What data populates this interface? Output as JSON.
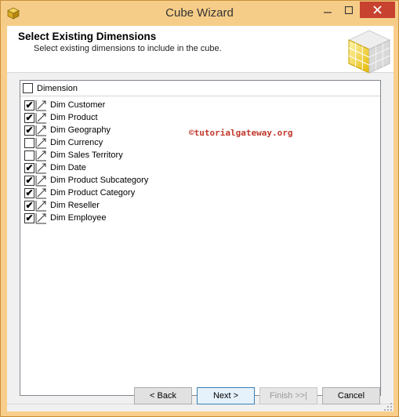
{
  "window": {
    "title": "Cube Wizard"
  },
  "header": {
    "title": "Select Existing Dimensions",
    "subtitle": "Select existing dimensions to include in the cube."
  },
  "list": {
    "column_header": "Dimension",
    "select_all_checked": false,
    "items": [
      {
        "label": "Dim Customer",
        "checked": true
      },
      {
        "label": "Dim Product",
        "checked": true
      },
      {
        "label": "Dim Geography",
        "checked": true
      },
      {
        "label": "Dim Currency",
        "checked": false
      },
      {
        "label": "Dim Sales Territory",
        "checked": false
      },
      {
        "label": "Dim Date",
        "checked": true
      },
      {
        "label": "Dim Product Subcategory",
        "checked": true
      },
      {
        "label": "Dim Product Category",
        "checked": true
      },
      {
        "label": "Dim Reseller",
        "checked": true
      },
      {
        "label": "Dim Employee",
        "checked": true
      }
    ]
  },
  "watermark": "©tutorialgateway.org",
  "buttons": {
    "back": "< Back",
    "next": "Next >",
    "finish": "Finish >>|",
    "cancel": "Cancel"
  },
  "colors": {
    "titlebar": "#f6cd88",
    "close_button": "#c7422f",
    "watermark": "#c0392b"
  }
}
